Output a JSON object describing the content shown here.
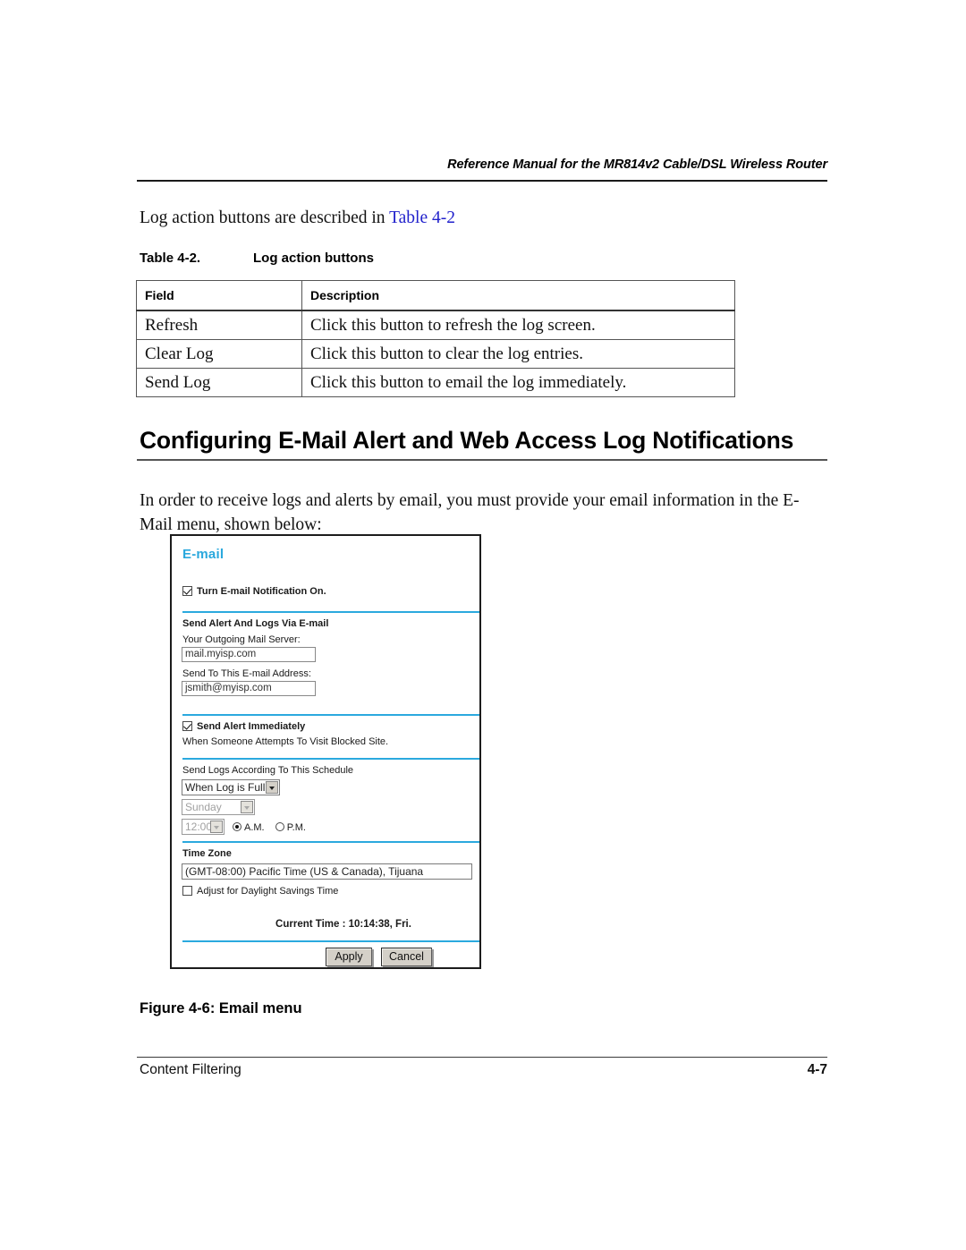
{
  "header": {
    "running_head": "Reference Manual for the MR814v2 Cable/DSL Wireless Router"
  },
  "intro": {
    "text_before": "Log action buttons are described in ",
    "xref": "Table 4-2"
  },
  "table_caption": {
    "number": "Table 4-2.",
    "title": "Log action buttons"
  },
  "table": {
    "headers": [
      "Field",
      "Description"
    ],
    "rows": [
      [
        "Refresh",
        "Click this button to refresh the log screen."
      ],
      [
        "Clear Log",
        "Click this button to clear the log entries."
      ],
      [
        "Send Log",
        "Click this button to email the log immediately."
      ]
    ]
  },
  "section": {
    "heading": "Configuring E-Mail Alert and Web Access Log Notifications",
    "paragraph": "In order to receive logs and alerts by email, you must provide your email information in the E-Mail menu, shown below:"
  },
  "email_menu": {
    "title": "E-mail",
    "notify_checkbox_label": "Turn E-mail Notification On.",
    "notify_checked": true,
    "section_alert_logs": "Send Alert And Logs Via E-mail",
    "outgoing_server_label": "Your Outgoing Mail Server:",
    "outgoing_server_value": "mail.myisp.com",
    "send_to_label": "Send To This E-mail Address:",
    "send_to_value": "jsmith@myisp.com",
    "send_alert_immediately_label": "Send Alert Immediately",
    "send_alert_immediately_checked": true,
    "send_alert_sub_label": "When Someone Attempts To Visit Blocked Site.",
    "schedule_label": "Send Logs According To This Schedule",
    "schedule_value": "When Log is Full",
    "day_value": "Sunday",
    "time_value": "12:00",
    "am_label": "A.M.",
    "pm_label": "P.M.",
    "am_selected": true,
    "time_zone_label": "Time Zone",
    "time_zone_value": "(GMT-08:00) Pacific Time (US & Canada), Tijuana",
    "dst_label": "Adjust for Daylight Savings Time",
    "dst_checked": false,
    "current_time": "Current Time : 10:14:38, Fri.",
    "apply_label": "Apply",
    "cancel_label": "Cancel",
    "accent_color": "#2ba9de"
  },
  "figure_caption": "Figure 4-6:  Email menu",
  "footer": {
    "left": "Content Filtering",
    "page": "4-7"
  }
}
